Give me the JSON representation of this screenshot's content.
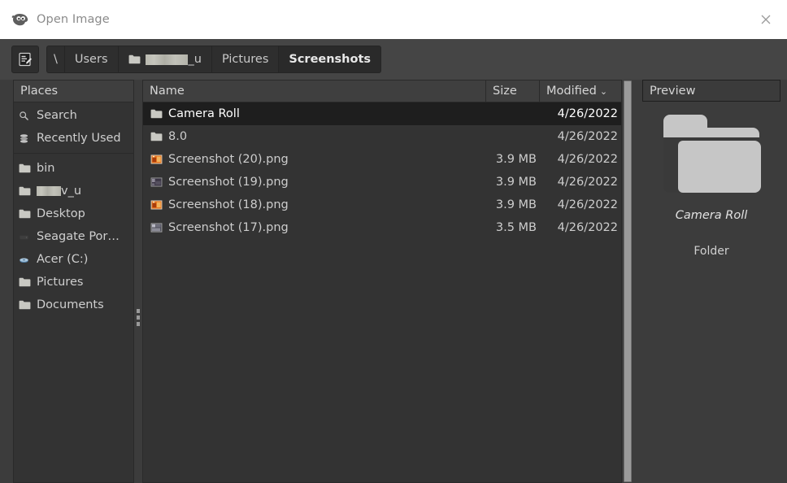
{
  "window": {
    "title": "Open Image",
    "title_icon": "gimp-wilber-icon",
    "close_label": "×"
  },
  "toolbar": {
    "location_button_icon": "type-filename-icon",
    "breadcrumbs": [
      {
        "label": "\\",
        "icon": "",
        "current": false
      },
      {
        "label": "Users",
        "icon": "",
        "current": false
      },
      {
        "label": "_u",
        "icon": "folder-icon",
        "redacted": true,
        "current": false
      },
      {
        "label": "Pictures",
        "icon": "",
        "current": false
      },
      {
        "label": "Screenshots",
        "icon": "",
        "current": true
      }
    ]
  },
  "sidebar": {
    "header": "Places",
    "items": [
      {
        "label": "Search",
        "icon": "search-icon"
      },
      {
        "label": "Recently Used",
        "icon": "recent-icon"
      },
      {
        "label": "bin",
        "icon": "folder-icon"
      },
      {
        "label": "v_u",
        "icon": "folder-icon",
        "redacted": true
      },
      {
        "label": "Desktop",
        "icon": "folder-icon"
      },
      {
        "label": "Seagate Por…",
        "icon": "drive-icon"
      },
      {
        "label": "Acer (C:)",
        "icon": "harddisk-icon"
      },
      {
        "label": "Pictures",
        "icon": "folder-icon"
      },
      {
        "label": "Documents",
        "icon": "folder-icon"
      }
    ]
  },
  "filelist": {
    "columns": {
      "name": "Name",
      "size": "Size",
      "modified": "Modified"
    },
    "sort_indicator": "⌄",
    "rows": [
      {
        "name": "Camera Roll",
        "size": "",
        "modified": "4/26/2022",
        "icon": "folder-icon",
        "selected": true
      },
      {
        "name": "8.0",
        "size": "",
        "modified": "4/26/2022",
        "icon": "folder-icon",
        "selected": false
      },
      {
        "name": "Screenshot (20).png",
        "size": "3.9 MB",
        "modified": "4/26/2022",
        "icon": "image-thumb-orange",
        "selected": false
      },
      {
        "name": "Screenshot (19).png",
        "size": "3.9 MB",
        "modified": "4/26/2022",
        "icon": "image-thumb-dark",
        "selected": false
      },
      {
        "name": "Screenshot (18).png",
        "size": "3.9 MB",
        "modified": "4/26/2022",
        "icon": "image-thumb-orange",
        "selected": false
      },
      {
        "name": "Screenshot (17).png",
        "size": "3.5 MB",
        "modified": "4/26/2022",
        "icon": "image-thumb-dark",
        "selected": false
      }
    ]
  },
  "preview": {
    "header": "Preview",
    "icon": "folder-icon-large",
    "name": "Camera Roll",
    "type": "Folder"
  },
  "colors": {
    "window_bg": "#3c3c3c",
    "panel_bg": "#333333",
    "titlebar_bg": "#ffffff",
    "toolbar_bg": "#454545",
    "selection_bg": "#1e1e1e",
    "text": "#cdcdcd",
    "folder_icon": "#c9c9c3",
    "scrollbar": "#9b9b9b"
  }
}
